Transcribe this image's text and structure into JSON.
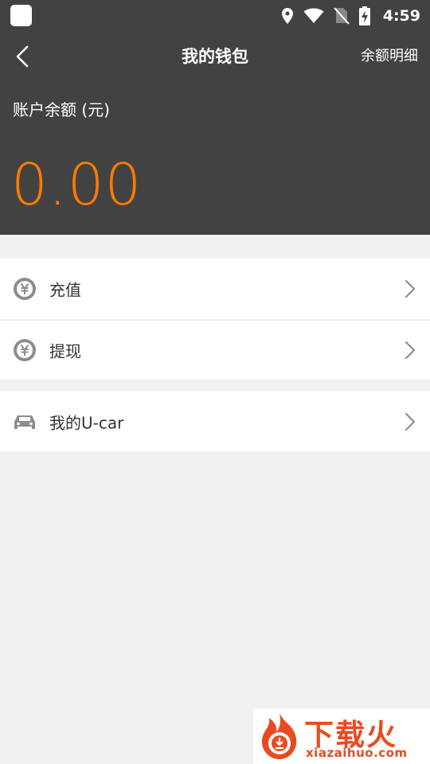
{
  "status_bar": {
    "time": "4:59",
    "icons": [
      "app-icon",
      "location-icon",
      "wifi-icon",
      "no-sim-icon",
      "battery-charging-icon"
    ]
  },
  "toolbar": {
    "title": "我的钱包",
    "detail_link": "余额明细",
    "back_icon": "chevron-left-icon"
  },
  "balance": {
    "label": "账户余额 (元)",
    "value": "0.00",
    "accent_color": "#ff7a00"
  },
  "menu": {
    "items": [
      {
        "label": "充值",
        "icon": "yen-coin-icon"
      },
      {
        "label": "提现",
        "icon": "yen-coin-icon"
      },
      {
        "label": "我的U-car",
        "icon": "car-icon"
      }
    ]
  },
  "watermark": {
    "title": "下载火",
    "url": "xiazaihuo.com",
    "logo": "fire-logo",
    "color": "#e84b21"
  },
  "colors": {
    "header_bg": "#424242",
    "page_bg": "#f1f1f1"
  }
}
